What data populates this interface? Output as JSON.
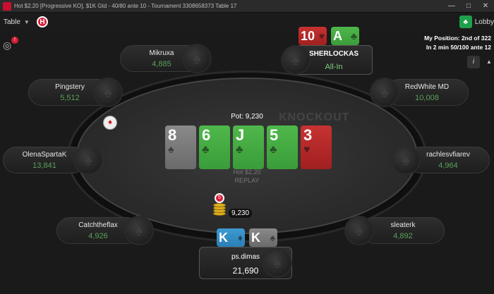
{
  "window": {
    "title": "Hot $2.20 [Progressive KO], $1K Gtd - 40/80 ante 10 - Tournament 3308658373 Table 17"
  },
  "menu": {
    "table_label": "Table",
    "hot_badge": "H",
    "lobby_label": "Lobby",
    "notification_count": "!"
  },
  "position_info": {
    "line1": "My Position: 2nd of 322",
    "line2": "In 2 min 50/100 ante 12"
  },
  "info_label": "i",
  "table": {
    "watermark": "KNOCKOUT",
    "pot_label": "Pot: 9,230",
    "name_line1": "Hot $2.20",
    "name_line2": "REPLAY"
  },
  "board": [
    {
      "rank": "8",
      "suit": "♠",
      "color": "#7a7a7a"
    },
    {
      "rank": "6",
      "suit": "♣",
      "color": "#45a845"
    },
    {
      "rank": "J",
      "suit": "♣",
      "color": "#45a845"
    },
    {
      "rank": "5",
      "suit": "♣",
      "color": "#45a845"
    },
    {
      "rank": "3",
      "suit": "♥",
      "color": "#b52828"
    }
  ],
  "players": {
    "mikruxa": {
      "name": "Mikruxa",
      "stack": "4,885"
    },
    "pingstery": {
      "name": "Pingstery",
      "stack": "5,512"
    },
    "olenasparta": {
      "name": "OlenaSpartaK",
      "stack": "13,841"
    },
    "catchtheflax": {
      "name": "Catchtheflax",
      "stack": "4,926"
    },
    "redwhite": {
      "name": "RedWhite MD",
      "stack": "10,008"
    },
    "rachlesv": {
      "name": "rachlesvfiarev",
      "stack": "4,964"
    },
    "sleaterk": {
      "name": "sleaterk",
      "stack": "4,892"
    },
    "sherlockas": {
      "name": "SHERLOCKAS",
      "stack": "All-In",
      "cards": [
        {
          "rank": "10",
          "suit": "♥"
        },
        {
          "rank": "A",
          "suit": "♣"
        }
      ]
    },
    "hero": {
      "name": "ps.dimas",
      "stack": "21,690",
      "cards": [
        {
          "rank": "K",
          "suit": "♦"
        },
        {
          "rank": "K",
          "suit": "♠"
        }
      ]
    }
  },
  "bet": {
    "amount": "9,230",
    "chip_label": "5"
  }
}
